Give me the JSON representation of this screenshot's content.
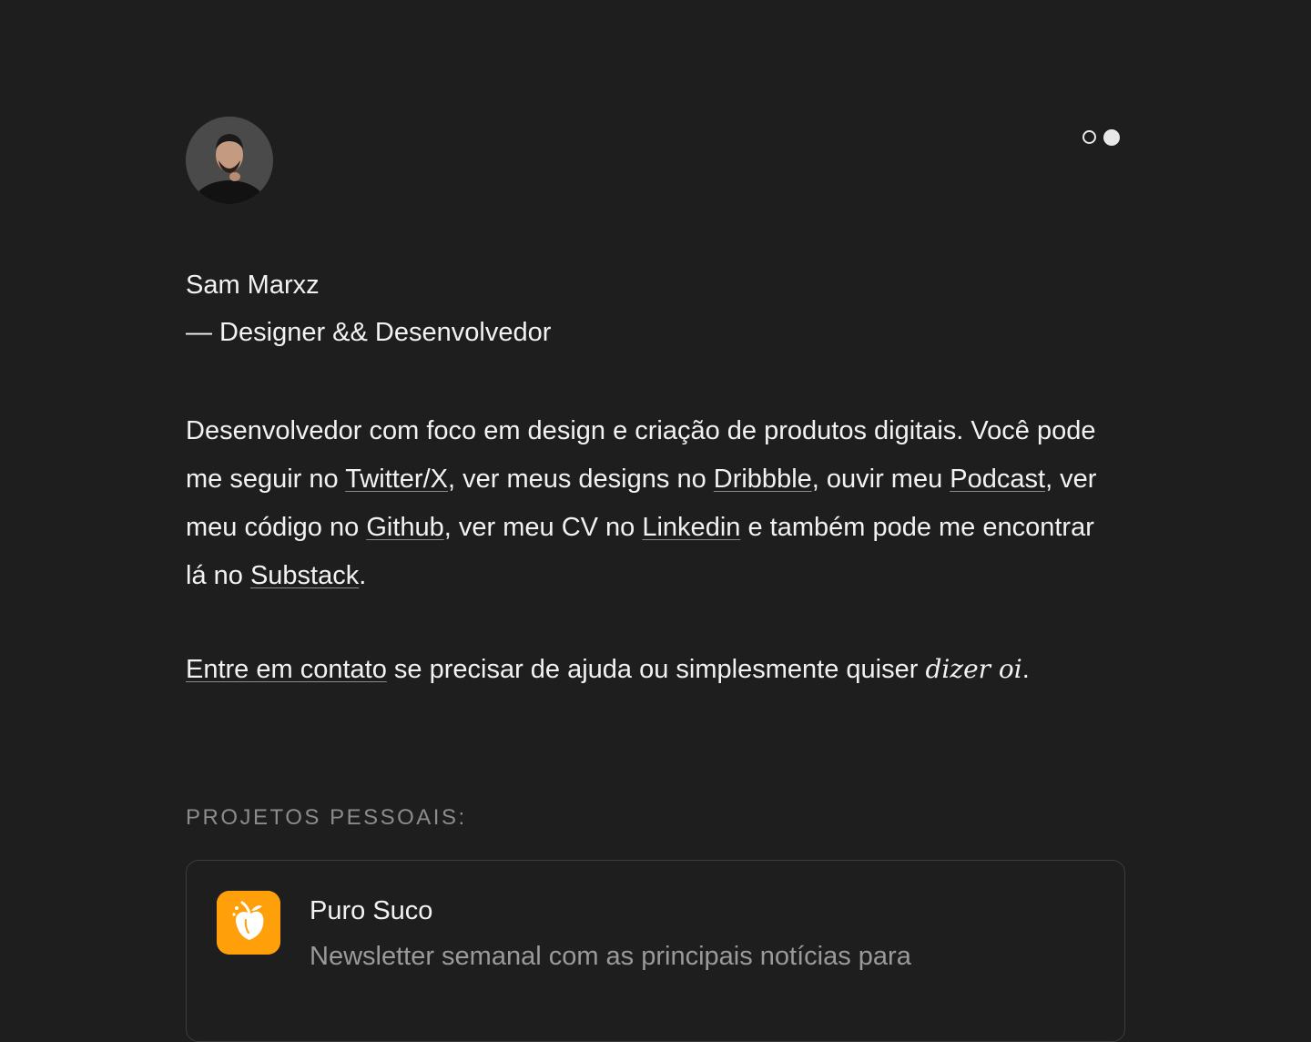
{
  "profile": {
    "name": "Sam Marxz",
    "role": "— Designer && Desenvolvedor"
  },
  "theme_toggle": {
    "light_label": "",
    "dark_label": ""
  },
  "bio": {
    "t1": "Desenvolvedor com foco em design e criação de produtos digitais. Você pode me seguir no ",
    "twitter": "Twitter/X",
    "t2": ", ver meus designs no ",
    "dribbble": "Dribbble",
    "t3": ", ouvir meu ",
    "podcast": "Podcast",
    "t4": ", ver meu código no ",
    "github": "Github",
    "t5": ", ver meu CV no ",
    "linkedin": "Linkedin",
    "t6": " e também pode me encontrar lá no ",
    "substack": "Substack",
    "t7": "."
  },
  "contact": {
    "link": "Entre em contato",
    "text": " se precisar de ajuda ou simplesmente quiser ",
    "italic": "dizer oi",
    "end": "."
  },
  "projects": {
    "label": "PROJETOS PESSOAIS:",
    "items": [
      {
        "title": "Puro Suco",
        "description": "Newsletter semanal com as principais notícias para",
        "icon": "orange-fruit-icon",
        "icon_color": "#ff9f0a"
      }
    ]
  },
  "colors": {
    "background": "#1e1e1e",
    "text": "#f2f2f2",
    "muted": "#8c8c8c"
  }
}
